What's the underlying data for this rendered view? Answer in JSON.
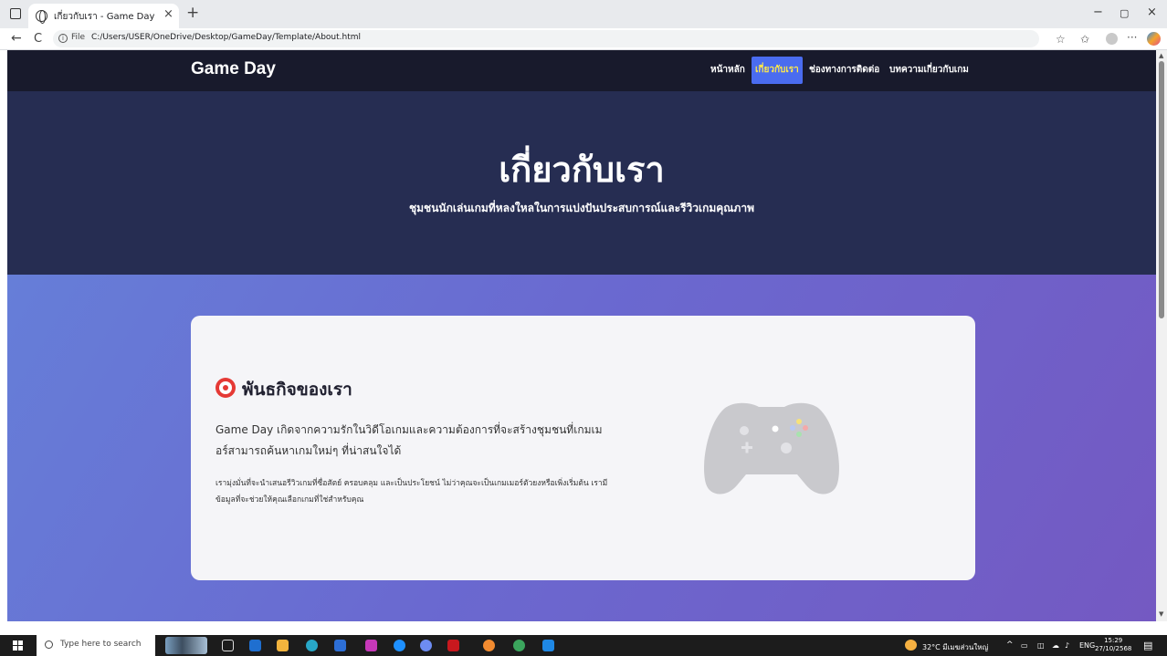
{
  "browser": {
    "tab_title": "เกี่ยวกับเรา - Game Day",
    "tab_close": "×",
    "new_tab": "+",
    "win_minimize": "−",
    "win_restore": "▢",
    "win_close": "×",
    "back": "←",
    "reload": "C",
    "file_label": "File",
    "address": "C:/Users/USER/OneDrive/Desktop/GameDay/Template/About.html",
    "more": "···"
  },
  "site": {
    "brand": "Game Day",
    "nav": [
      {
        "label": "หน้าหลัก",
        "active": false
      },
      {
        "label": "เกี่ยวกับเรา",
        "active": true
      },
      {
        "label": "ช่องทางการติดต่อ",
        "active": false
      },
      {
        "label": "บทความเกี่ยวกับเกม",
        "active": false
      }
    ],
    "active_color": "#4a6cf0",
    "active_text_color": "#ffe94a"
  },
  "hero": {
    "title": "เกี่ยวกับเรา",
    "subtitle": "ชุมชนนักเล่นเกมที่หลงใหลในการแบ่งปันประสบการณ์และรีวิวเกมคุณภาพ"
  },
  "mission": {
    "icon": "target-icon",
    "title": "พันธกิจของเรา",
    "lead": "Game Day เกิดจากความรักในวิดีโอเกมและความต้องการที่จะสร้างชุมชนที่เกมเมอร์สามารถค้นหาเกมใหม่ๆ ที่น่าสนใจได้",
    "body": "เรามุ่งมั่นที่จะนำเสนอรีวิวเกมที่ซื่อสัตย์ ครอบคลุม และเป็นประโยชน์ ไม่ว่าคุณจะเป็นเกมเมอร์ตัวยงหรือเพิ่งเริ่มต้น เรามีข้อมูลที่จะช่วยให้คุณเลือกเกมที่ใช่สำหรับคุณ",
    "illustration": "game-controller-icon"
  },
  "taskbar": {
    "search_placeholder": "Type here to search",
    "weather": "32°C มีเมฆส่วนใหญ่",
    "language": "ENG",
    "time": "15:29",
    "date": "27/10/2568"
  }
}
